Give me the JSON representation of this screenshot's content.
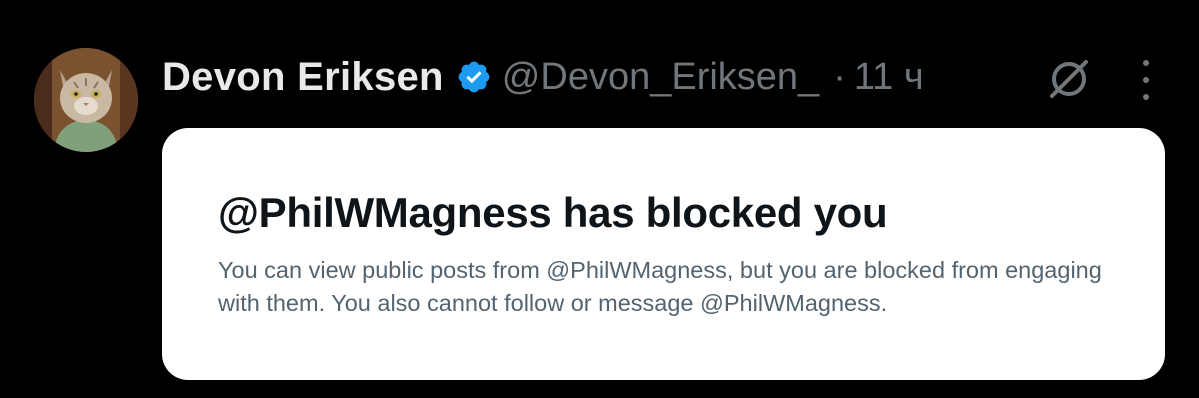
{
  "post": {
    "author_name": "Devon Eriksen",
    "handle": "@Devon_Eriksen_",
    "separator": "·",
    "time": "11 ч"
  },
  "notice": {
    "title": "@PhilWMagness has blocked you",
    "body": "You can view public posts from @PhilWMagness, but you are blocked from engaging with them. You also cannot follow or message @PhilWMagness."
  },
  "icons": {
    "avatar": "cat-avatar",
    "verified": "verified-badge-icon",
    "grok": "grok-icon",
    "more": "more-icon"
  },
  "colors": {
    "background": "#000000",
    "name": "#e7e9ea",
    "secondary": "#71767b",
    "verified": "#1d9bf0",
    "card": "#ffffff",
    "card_title": "#0f1419",
    "card_body": "#536471"
  }
}
